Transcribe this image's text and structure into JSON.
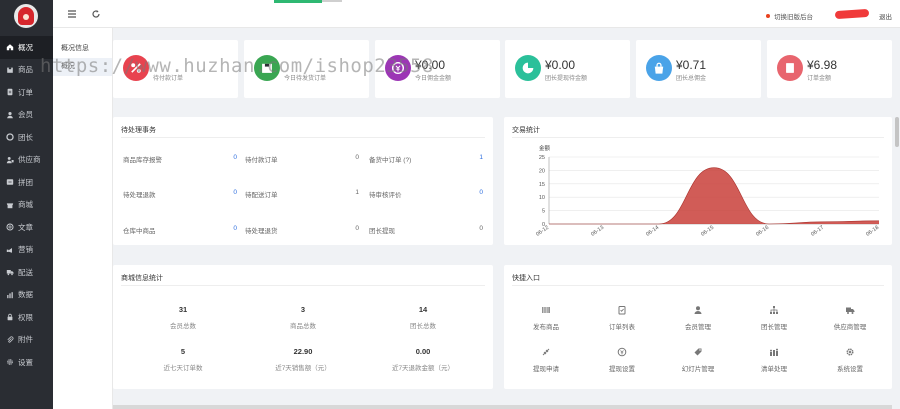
{
  "sidebar": {
    "items": [
      {
        "label": "概况",
        "icon": "home-icon"
      },
      {
        "label": "商品",
        "icon": "box-icon"
      },
      {
        "label": "订单",
        "icon": "order-icon"
      },
      {
        "label": "会员",
        "icon": "user-icon"
      },
      {
        "label": "团长",
        "icon": "circle-icon"
      },
      {
        "label": "供应商",
        "icon": "supplier-icon"
      },
      {
        "label": "拼团",
        "icon": "group-icon"
      },
      {
        "label": "商城",
        "icon": "shop-icon"
      },
      {
        "label": "文章",
        "icon": "article-icon"
      },
      {
        "label": "营销",
        "icon": "marketing-icon"
      },
      {
        "label": "配送",
        "icon": "truck-icon"
      },
      {
        "label": "数据",
        "icon": "chart-icon"
      },
      {
        "label": "权限",
        "icon": "lock-icon"
      },
      {
        "label": "附件",
        "icon": "attachment-icon"
      },
      {
        "label": "设置",
        "icon": "gear-icon"
      }
    ]
  },
  "submenu": {
    "items": [
      {
        "label": "概况信息"
      },
      {
        "label": "概况"
      }
    ]
  },
  "topbar": {
    "switch_label": "切换旧版后台",
    "logout_label": "退出"
  },
  "watermark": "https://www.huzhan.com/ishop23558",
  "stats": [
    {
      "value": "",
      "label": "待付款订单",
      "color": "#e8434f",
      "icon": "percent-icon"
    },
    {
      "value": "",
      "label": "今日待发货订单",
      "color": "#3aa652",
      "icon": "box-icon"
    },
    {
      "value": "¥0.00",
      "label": "今日佣金金额",
      "color": "#9c36b5",
      "icon": "coin-icon"
    },
    {
      "value": "¥0.00",
      "label": "团长提现待金额",
      "color": "#2bc09a",
      "icon": "pie-icon"
    },
    {
      "value": "¥0.71",
      "label": "团长总佣金",
      "color": "#4aa3e8",
      "icon": "bag-icon"
    },
    {
      "value": "¥6.98",
      "label": "订单金额",
      "color": "#e8656e",
      "icon": "document-icon"
    }
  ],
  "pending": {
    "title": "待处理事务",
    "rows": [
      [
        {
          "label": "商品库存报警",
          "value": "0",
          "color": "blue"
        },
        {
          "label": "待付款订单",
          "value": "0",
          "color": "gray"
        },
        {
          "label": "备货中订单 (?)",
          "value": "1",
          "color": "blue"
        }
      ],
      [
        {
          "label": "待处理退款",
          "value": "0",
          "color": "blue"
        },
        {
          "label": "待配送订单",
          "value": "1",
          "color": "gray"
        },
        {
          "label": "待审核评价",
          "value": "0",
          "color": "blue"
        }
      ],
      [
        {
          "label": "仓库中商品",
          "value": "0",
          "color": "blue"
        },
        {
          "label": "待处理退货",
          "value": "0",
          "color": "gray"
        },
        {
          "label": "团长提现",
          "value": "0",
          "color": "gray"
        }
      ]
    ]
  },
  "chart_data": {
    "type": "area",
    "title": "交易统计",
    "ylabel": "金额",
    "ylim": [
      0,
      25
    ],
    "yticks": [
      0,
      5,
      10,
      15,
      20,
      25
    ],
    "categories": [
      "06-12",
      "06-13",
      "06-14",
      "06-15",
      "06-16",
      "06-17",
      "06-18"
    ],
    "values": [
      0,
      0,
      0,
      21,
      0,
      0.8,
      1.2
    ],
    "color": "#c9403a",
    "grid": true
  },
  "mall": {
    "title": "商城信息统计",
    "cells": [
      {
        "value": "31",
        "label": "会员总数"
      },
      {
        "value": "3",
        "label": "商品总数"
      },
      {
        "value": "14",
        "label": "团长总数"
      },
      {
        "value": "5",
        "label": "近七天订单数"
      },
      {
        "value": "22.90",
        "label": "近7天销售额（元）"
      },
      {
        "value": "0.00",
        "label": "近7天退款金额（元）"
      }
    ]
  },
  "quick": {
    "title": "快捷入口",
    "items": [
      {
        "label": "发布商品",
        "icon": "barcode-icon"
      },
      {
        "label": "订单列表",
        "icon": "clipboard-icon"
      },
      {
        "label": "会员管理",
        "icon": "user-icon"
      },
      {
        "label": "团长管理",
        "icon": "org-icon"
      },
      {
        "label": "供应商管理",
        "icon": "truck-icon"
      },
      {
        "label": "提现申请",
        "icon": "tag-icon"
      },
      {
        "label": "提现设置",
        "icon": "coin-icon"
      },
      {
        "label": "幻灯片管理",
        "icon": "price-tag-icon"
      },
      {
        "label": "清单处理",
        "icon": "people-icon"
      },
      {
        "label": "系统设置",
        "icon": "gear-icon"
      }
    ]
  }
}
